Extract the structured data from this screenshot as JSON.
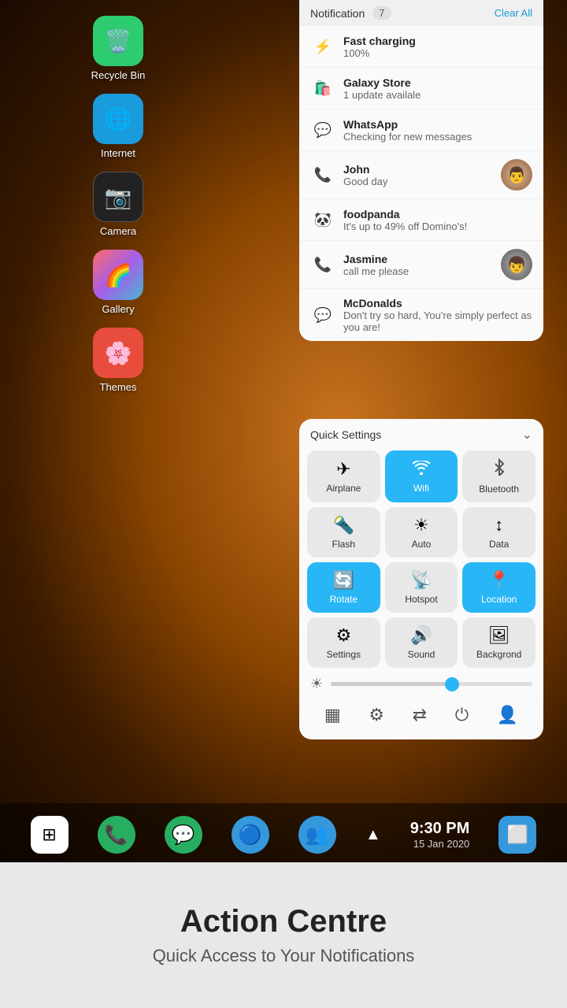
{
  "phone": {
    "notification_panel": {
      "header": {
        "title": "Notification",
        "count": "7",
        "clear_button": "Clear All"
      },
      "notifications": [
        {
          "id": "fast-charging",
          "icon": "⚡",
          "title": "Fast charging",
          "description": "100%",
          "has_avatar": false
        },
        {
          "id": "galaxy-store",
          "icon": "🛍",
          "title": "Galaxy Store",
          "description": "1 update availale",
          "has_avatar": false
        },
        {
          "id": "whatsapp",
          "icon": "💬",
          "title": "WhatsApp",
          "description": "Checking for new messages",
          "has_avatar": false
        },
        {
          "id": "john",
          "icon": "📞",
          "title": "John",
          "description": "Good day",
          "has_avatar": true,
          "avatar_type": "john"
        },
        {
          "id": "foodpanda",
          "icon": "🐼",
          "title": "foodpanda",
          "description": "It's up to 49% off Domino's!",
          "has_avatar": false
        },
        {
          "id": "jasmine",
          "icon": "📞",
          "title": "Jasmine",
          "description": "call me please",
          "has_avatar": true,
          "avatar_type": "jasmine"
        },
        {
          "id": "mcdonalds",
          "icon": "💬",
          "title": "McDonalds",
          "description": "Don't try so hard, You're simply perfect as you are!",
          "has_avatar": false
        }
      ]
    },
    "quick_settings": {
      "title": "Quick Settings",
      "tiles": [
        {
          "id": "airplane",
          "icon": "✈️",
          "label": "Airplane",
          "active": false
        },
        {
          "id": "wifi",
          "icon": "📶",
          "label": "Wifi",
          "active": true
        },
        {
          "id": "bluetooth",
          "icon": "🔷",
          "label": "Bluetooth",
          "active": false
        },
        {
          "id": "flash",
          "icon": "🔦",
          "label": "Flash",
          "active": false
        },
        {
          "id": "auto",
          "icon": "☀️",
          "label": "Auto",
          "active": false
        },
        {
          "id": "data",
          "icon": "↕️",
          "label": "Data",
          "active": false
        },
        {
          "id": "rotate",
          "icon": "🔄",
          "label": "Rotate",
          "active": true
        },
        {
          "id": "hotspot",
          "icon": "📡",
          "label": "Hotspot",
          "active": false
        },
        {
          "id": "location",
          "icon": "📍",
          "label": "Location",
          "active": true
        },
        {
          "id": "settings",
          "icon": "⚙️",
          "label": "Settings",
          "active": false
        },
        {
          "id": "sound",
          "icon": "🔊",
          "label": "Sound",
          "active": false
        },
        {
          "id": "background",
          "icon": "🖼️",
          "label": "Backgrond",
          "active": false
        }
      ],
      "brightness": 60
    },
    "apps": [
      {
        "id": "recycle-bin",
        "icon": "🗑️",
        "icon_bg": "#2ecc71",
        "label": "Recycle Bin"
      },
      {
        "id": "internet",
        "icon": "🌐",
        "icon_bg": "#1a9bdc",
        "label": "Internet"
      },
      {
        "id": "camera",
        "icon": "📷",
        "icon_bg": "#222",
        "label": "Camera"
      },
      {
        "id": "gallery",
        "icon": "🌈",
        "icon_bg": "#9b59b6",
        "label": "Gallery"
      },
      {
        "id": "themes",
        "icon": "🌸",
        "icon_bg": "#e74c3c",
        "label": "Themes"
      }
    ],
    "dock": {
      "apps": [
        {
          "id": "samsung-apps",
          "icon": "⊞",
          "bg": "transparent"
        },
        {
          "id": "phone",
          "icon": "📞",
          "bg": "#27ae60"
        },
        {
          "id": "messages",
          "icon": "💬",
          "bg": "#27ae60"
        },
        {
          "id": "find-my",
          "icon": "🔵",
          "bg": "#3498db"
        },
        {
          "id": "contacts",
          "icon": "👥",
          "bg": "#3498db"
        }
      ],
      "time": "9:30 PM",
      "date": "15 Jan  2020"
    }
  },
  "bottom_section": {
    "title": "Action Centre",
    "subtitle": "Quick Access to Your Notifications"
  }
}
